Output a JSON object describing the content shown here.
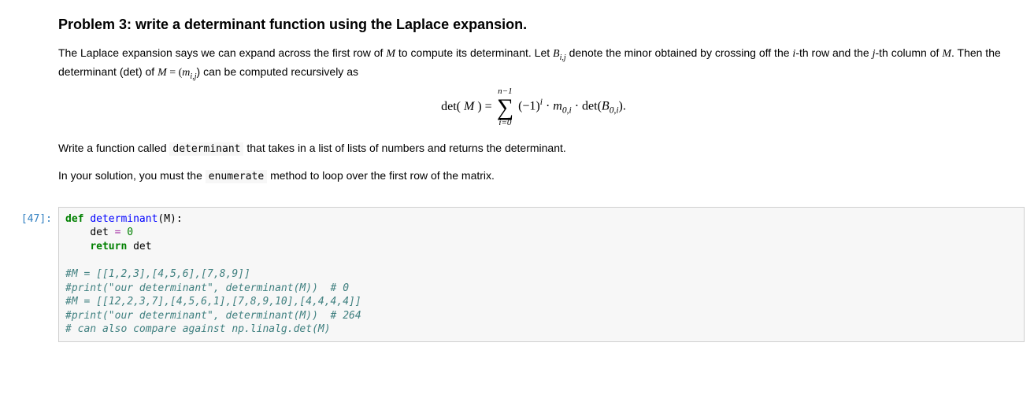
{
  "heading": "Problem 3: write a determinant function using the Laplace expansion.",
  "intro": {
    "part1": "The Laplace expansion says we can expand across the first row of ",
    "M1": "M",
    "part2": " to compute its determinant. Let ",
    "B": "B",
    "Bsub": "i,j",
    "part3": " denote the minor obtained by crossing off the ",
    "i": "i",
    "part4": "-th row and the ",
    "j": "j",
    "part5": "-th column of ",
    "M2": "M",
    "part6": ". Then the determinant (det) of ",
    "M3": "M",
    "eqr": " = (",
    "m": "m",
    "msub": "i,j",
    "part7": ") can be computed recursively as"
  },
  "displaymath": {
    "det_open": "det(",
    "M": "M",
    "close_eq": ") = ",
    "sigma_top": "n−1",
    "sigma_sym": "∑",
    "sigma_bot": "i=0",
    "neg1": "(−1)",
    "exp_i": "i",
    "dot1": " · ",
    "m0": "m",
    "m0sub": "0,i",
    "dot2": " · det(",
    "B0": "B",
    "B0sub": "0,i",
    "tail": ")."
  },
  "para2": {
    "t1": "Write a function called ",
    "code": "determinant",
    "t2": " that takes in a list of lists of numbers and returns the determinant."
  },
  "para3": {
    "t1": "In your solution, you must the ",
    "code": "enumerate",
    "t2": " method to loop over the first row of the matrix."
  },
  "prompt": "[47]:",
  "code": {
    "kw_def": "def",
    "fn_name": "determinant",
    "sig_tail": "(M):",
    "indent": "    ",
    "assign_l": "det ",
    "op_eq": "=",
    "zero": " 0",
    "kw_return": "return",
    "ret_tail": " det",
    "c1": "#M = [[1,2,3],[4,5,6],[7,8,9]]",
    "c2": "#print(\"our determinant\", determinant(M))  # 0",
    "c3": "#M = [[12,2,3,7],[4,5,6,1],[7,8,9,10],[4,4,4,4]]",
    "c4": "#print(\"our determinant\", determinant(M))  # 264",
    "c5": "# can also compare against np.linalg.det(M)"
  }
}
